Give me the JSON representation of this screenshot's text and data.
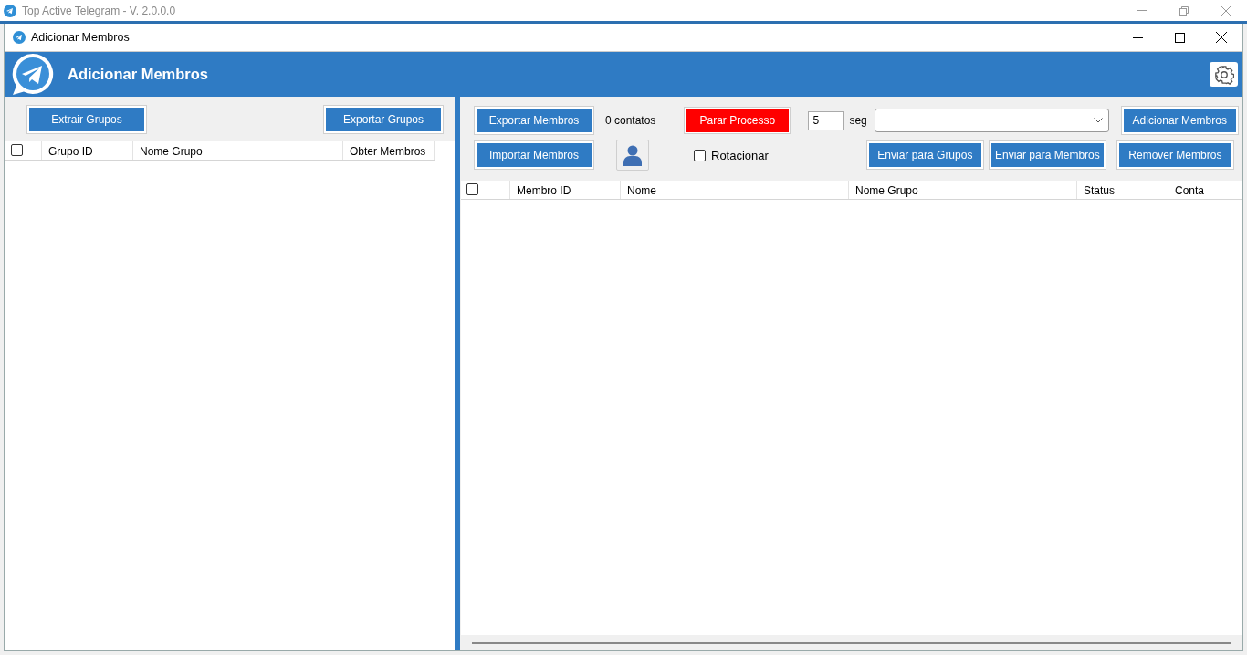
{
  "app_window": {
    "title": "Top Active Telegram - V. 2.0.0.0"
  },
  "window": {
    "title": "Adicionar Membros"
  },
  "header": {
    "title": "Adicionar Membros"
  },
  "left_panel": {
    "buttons": [
      "Extrair Grupos",
      "Exportar Grupos"
    ],
    "table": {
      "select_all_checked": false,
      "columns": [
        "Grupo ID",
        "Nome Grupo",
        "Obter Membros"
      ]
    }
  },
  "right_panel": {
    "export_button": "Exportar Membros",
    "import_button": "Importar Membros",
    "contacts_count": "0 contatos",
    "stop_button": "Parar Processo",
    "delay": {
      "value": "5",
      "unit": "seg"
    },
    "rotate": {
      "label": "Rotacionar",
      "checked": false
    },
    "add_button": "Adicionar Membros",
    "send_buttons": [
      "Enviar para Grupos",
      "Enviar para Membros"
    ],
    "remove_button": "Remover Membros",
    "table": {
      "select_all_checked": false,
      "columns": [
        "Membro ID",
        "Nome",
        "Nome Grupo",
        "Status",
        "Conta"
      ]
    }
  }
}
